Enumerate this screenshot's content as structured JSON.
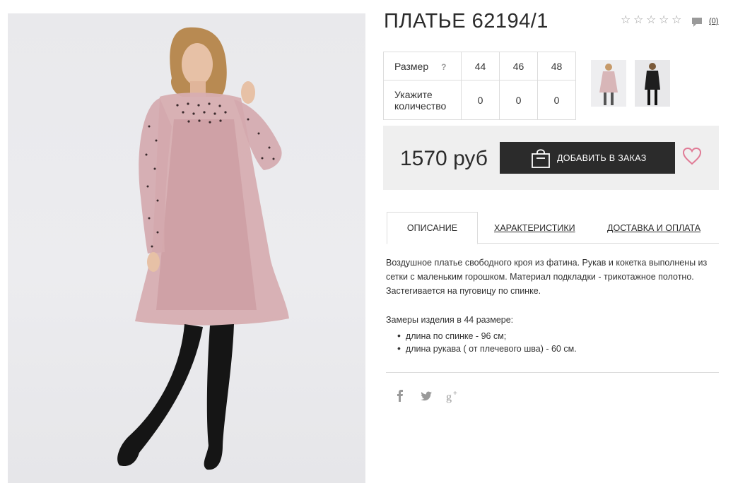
{
  "product": {
    "title": "ПЛАТЬЕ 62194/1",
    "reviews_count": "(0)",
    "rating_stars": 0
  },
  "sizes": {
    "size_label": "Размер",
    "help": "?",
    "qty_label": "Укажите количество",
    "columns": [
      "44",
      "46",
      "48"
    ],
    "quantities": [
      "0",
      "0",
      "0"
    ]
  },
  "price": {
    "value": "1570 руб",
    "add_button": "ДОБАВИТЬ В ЗАКАЗ"
  },
  "tabs": [
    {
      "label": "ОПИСАНИЕ",
      "active": true
    },
    {
      "label": "ХАРАКТЕРИСТИКИ",
      "active": false
    },
    {
      "label": "ДОСТАВКА И ОПЛАТА",
      "active": false
    }
  ],
  "description": {
    "text": "Воздушное платье свободного кроя из фатина. Рукав и кокетка выполнены из сетки с маленьким горошком. Материал подкладки - трикотажное полотно. Застегивается на пуговицу по спинке.",
    "measure_title": "Замеры изделия в 44 размере:",
    "measures": [
      "длина по спинке - 96 см;",
      "длина рукава ( от плечевого шва) - 60 см."
    ]
  },
  "social": [
    "f",
    "twitter",
    "g+"
  ],
  "colors": {
    "button_bg": "#2b2b2b",
    "heart": "#e07a95",
    "price_box_bg": "#efefef",
    "dress": "#d7aeb1"
  }
}
